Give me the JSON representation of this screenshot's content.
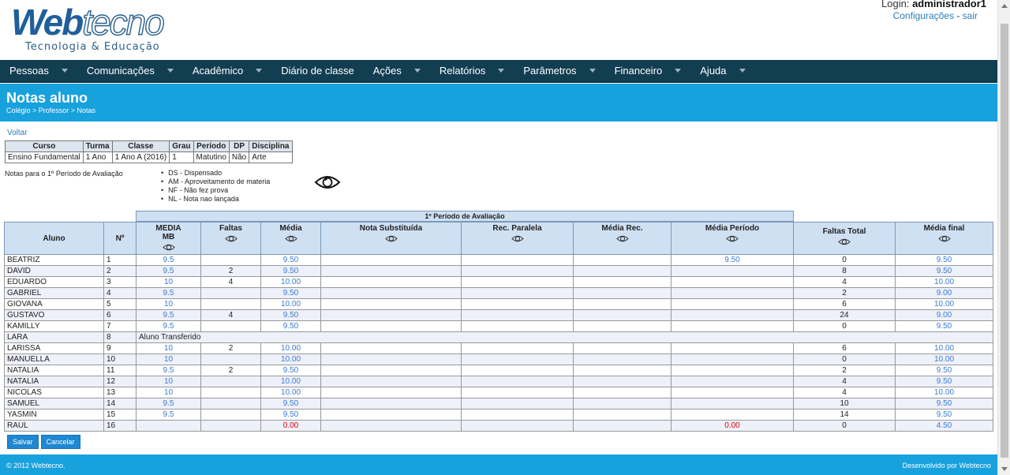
{
  "header": {
    "logo_word_a": "Web",
    "logo_word_b": "tecno",
    "logo_sub": "Tecnologia & Educação",
    "login_prefix": "Login: ",
    "login_user": "administrador1",
    "config_link": "Configurações",
    "sep": " - ",
    "logout_link": "sair"
  },
  "nav": [
    {
      "label": "Pessoas",
      "caret": true
    },
    {
      "label": "Comunicações",
      "caret": true
    },
    {
      "label": "Acadêmico",
      "caret": true
    },
    {
      "label": "Diário de classe",
      "caret": false
    },
    {
      "label": "Ações",
      "caret": true
    },
    {
      "label": "Relatórios",
      "caret": true
    },
    {
      "label": "Parâmetros",
      "caret": true
    },
    {
      "label": "Financeiro",
      "caret": true
    },
    {
      "label": "Ajuda",
      "caret": true
    }
  ],
  "page": {
    "title": "Notas aluno",
    "breadcrumb": "Colégio > Professor > Notas",
    "back": "Voltar"
  },
  "info_table": {
    "headers": [
      "Curso",
      "Turma",
      "Classe",
      "Grau",
      "Período",
      "DP",
      "Disciplina"
    ],
    "values": [
      "Ensino Fundamental",
      "1 Ano",
      "1 Ano A (2016)",
      "1",
      "Matutino",
      "Não",
      "Arte"
    ]
  },
  "notes_label": "Notas para o 1º Período de Avaliação",
  "legend": [
    "DS - Dispensado",
    "AM - Aproveitamento de materia",
    "NF - Não fez prova",
    "NL - Nota nao lançada"
  ],
  "grid": {
    "period_title": "1º Período de Avaliação",
    "columns": [
      "Aluno",
      "Nº",
      "MEDIA MB",
      "Faltas",
      "Média",
      "Nota Substituída",
      "Rec. Paralela",
      "Média Rec.",
      "Média Período",
      "Faltas Total",
      "Média final"
    ],
    "rows": [
      {
        "aluno": "BEATRIZ",
        "n": "1",
        "mb": "9.5",
        "faltas": "",
        "media": "9.50",
        "media_periodo": "9.50",
        "faltas_total": "0",
        "final": "9.50"
      },
      {
        "aluno": "DAVID",
        "n": "2",
        "mb": "9.5",
        "faltas": "2",
        "media": "9.50",
        "media_periodo": "",
        "faltas_total": "8",
        "final": "9.50"
      },
      {
        "aluno": "EDUARDO",
        "n": "3",
        "mb": "10",
        "faltas": "4",
        "media": "10.00",
        "media_periodo": "",
        "faltas_total": "4",
        "final": "10.00"
      },
      {
        "aluno": "GABRIEL",
        "n": "4",
        "mb": "9.5",
        "faltas": "",
        "media": "9.50",
        "media_periodo": "",
        "faltas_total": "2",
        "final": "9.00"
      },
      {
        "aluno": "GIOVANA",
        "n": "5",
        "mb": "10",
        "faltas": "",
        "media": "10.00",
        "media_periodo": "",
        "faltas_total": "6",
        "final": "10.00"
      },
      {
        "aluno": "GUSTAVO",
        "n": "6",
        "mb": "9.5",
        "faltas": "4",
        "media": "9.50",
        "media_periodo": "",
        "faltas_total": "24",
        "final": "9.00"
      },
      {
        "aluno": "KAMILLY",
        "n": "7",
        "mb": "9.5",
        "faltas": "",
        "media": "9.50",
        "media_periodo": "",
        "faltas_total": "0",
        "final": "9.50"
      },
      {
        "aluno": "LARA",
        "n": "8",
        "transferred": "Aluno Transferido"
      },
      {
        "aluno": "LARISSA",
        "n": "9",
        "mb": "10",
        "faltas": "2",
        "media": "10.00",
        "media_periodo": "",
        "faltas_total": "6",
        "final": "10.00"
      },
      {
        "aluno": "MANUELLA",
        "n": "10",
        "mb": "10",
        "faltas": "",
        "media": "10.00",
        "media_periodo": "",
        "faltas_total": "0",
        "final": "10.00"
      },
      {
        "aluno": "NATALIA",
        "n": "11",
        "mb": "9.5",
        "faltas": "2",
        "media": "9.50",
        "media_periodo": "",
        "faltas_total": "2",
        "final": "9.50"
      },
      {
        "aluno": "NATALIA",
        "n": "12",
        "mb": "10",
        "faltas": "",
        "media": "10.00",
        "media_periodo": "",
        "faltas_total": "4",
        "final": "9.50"
      },
      {
        "aluno": "NICOLAS",
        "n": "13",
        "mb": "10",
        "faltas": "",
        "media": "10.00",
        "media_periodo": "",
        "faltas_total": "4",
        "final": "10.00"
      },
      {
        "aluno": "SAMUEL",
        "n": "14",
        "mb": "9.5",
        "faltas": "",
        "media": "9.50",
        "media_periodo": "",
        "faltas_total": "10",
        "final": "9.50"
      },
      {
        "aluno": "YASMIN",
        "n": "15",
        "mb": "9.5",
        "faltas": "",
        "media": "9.50",
        "media_periodo": "",
        "faltas_total": "14",
        "final": "9.50"
      },
      {
        "aluno": "RAUL",
        "n": "16",
        "mb": "",
        "faltas": "",
        "media": "0.00",
        "media_periodo": "0.00",
        "faltas_total": "0",
        "final": "4.50",
        "zero": true
      }
    ]
  },
  "buttons": {
    "save": "Salvar",
    "cancel": "Cancelar"
  },
  "footer": {
    "left": "© 2012 Webtecno.",
    "right": "Desenvolvido por Webtecno"
  },
  "colors": {
    "nav_bg": "#123e52",
    "band_bg": "#17a1dd",
    "value_blue": "#3a7bd0",
    "value_red": "#dd0000"
  }
}
